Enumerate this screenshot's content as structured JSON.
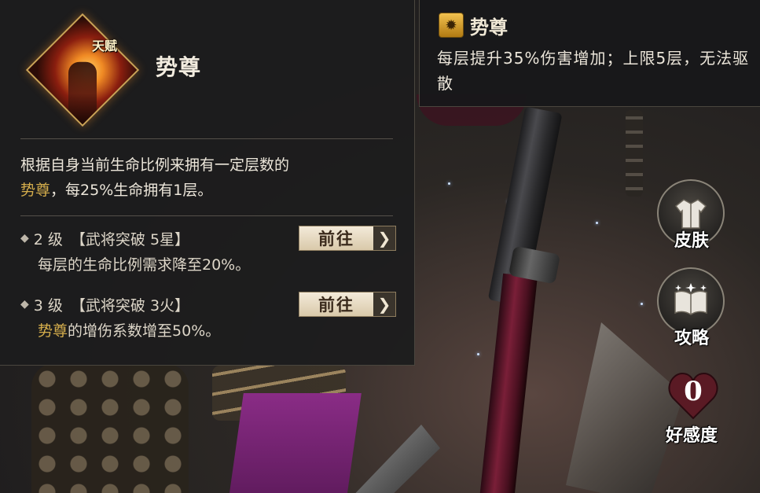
{
  "talent": {
    "tag": "天赋",
    "name": "势尊",
    "description_highlight": "势尊",
    "description_line1": "根据自身当前生命比例来拥有一定层数的",
    "description_rest": "，每25%生命拥有1层。",
    "upgrades": [
      {
        "level": "2 级",
        "requirement": "【武将突破 5星】",
        "desc_highlight": "",
        "desc": "每层的生命比例需求降至20%。",
        "button_label": "前往"
      },
      {
        "level": "3 级",
        "requirement": "【武将突破 3火】",
        "desc_highlight": "势尊",
        "desc": "的增伤系数增至50%。",
        "button_label": "前往"
      }
    ]
  },
  "buff_tooltip": {
    "title": "势尊",
    "description": "每层提升35%伤害增加；上限5层，无法驱散"
  },
  "side_buttons": {
    "skin_label": "皮肤",
    "guide_label": "攻略",
    "affinity_label": "好感度",
    "affinity_value": "0"
  },
  "colors": {
    "highlight": "#d4ad4c",
    "panel_bg": "#1c1c1e",
    "button_bg": "#e8dcc3",
    "heart": "#5a1a24"
  },
  "icons": {
    "skin": "robe-icon",
    "guide": "book-icon",
    "affinity": "heart-icon",
    "upgrade_button": "double-chevron-right-icon",
    "buff": "flame-mask-icon"
  }
}
